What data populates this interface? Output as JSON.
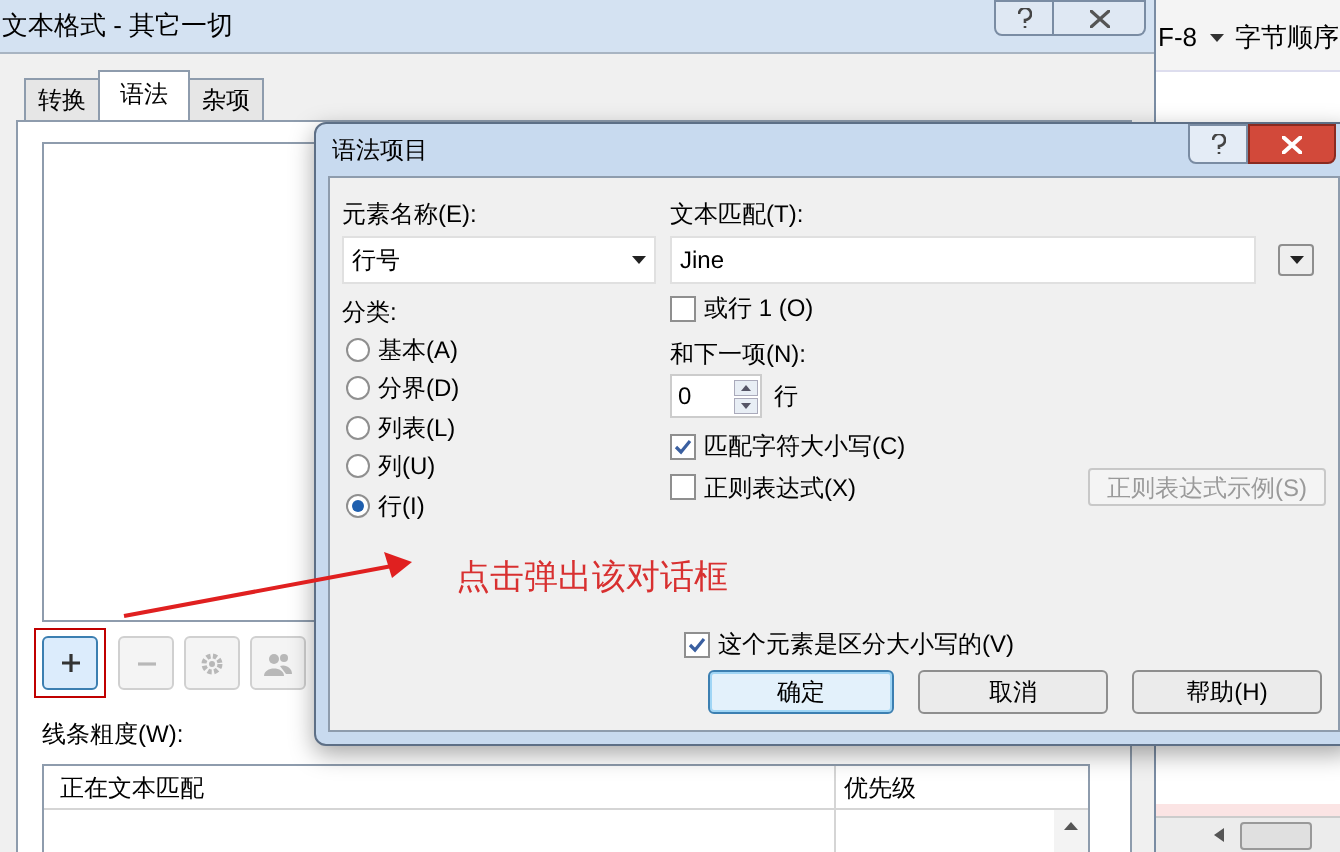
{
  "back_window": {
    "title": "文本格式 - 其它一切",
    "tabs": [
      {
        "label": "转换",
        "selected": false
      },
      {
        "label": "语法",
        "selected": true
      },
      {
        "label": "杂项",
        "selected": false
      }
    ],
    "toolbar": [
      {
        "kind": "add",
        "disabled": false
      },
      {
        "kind": "remove",
        "disabled": true
      },
      {
        "kind": "settings",
        "disabled": true
      },
      {
        "kind": "group",
        "disabled": true
      }
    ],
    "line_width_label": "线条粗度(W):",
    "table_columns": [
      "正在文本匹配",
      "优先级"
    ]
  },
  "side_app": {
    "encoding": "F-8",
    "byte_order": "字节顺序"
  },
  "dialog": {
    "title": "语法项目",
    "element_name_label": "元素名称(E):",
    "element_name_value": "行号",
    "category_label": "分类:",
    "categories": [
      {
        "label": "基本(A)",
        "selected": false
      },
      {
        "label": "分界(D)",
        "selected": false
      },
      {
        "label": "列表(L)",
        "selected": false
      },
      {
        "label": "列(U)",
        "selected": false
      },
      {
        "label": "行(I)",
        "selected": true
      }
    ],
    "text_match_label": "文本匹配(T):",
    "text_match_value": "Jine",
    "or_line": {
      "label": "或行 1 (O)",
      "checked": false
    },
    "next_label": "和下一项(N):",
    "next_value": "0",
    "next_unit": "行",
    "match_case": {
      "label": "匹配字符大小写(C)",
      "checked": true
    },
    "regex": {
      "label": "正则表达式(X)",
      "checked": false
    },
    "regex_example": {
      "label": "正则表达式示例(S)",
      "disabled": true
    },
    "case_sensitive": {
      "label": "这个元素是区分大小写的(V)",
      "checked": true
    },
    "buttons": [
      {
        "label": "确定",
        "default": true
      },
      {
        "label": "取消",
        "default": false
      },
      {
        "label": "帮助(H)",
        "default": false
      }
    ]
  },
  "annotation": {
    "text": "点击弹出该对话框"
  }
}
